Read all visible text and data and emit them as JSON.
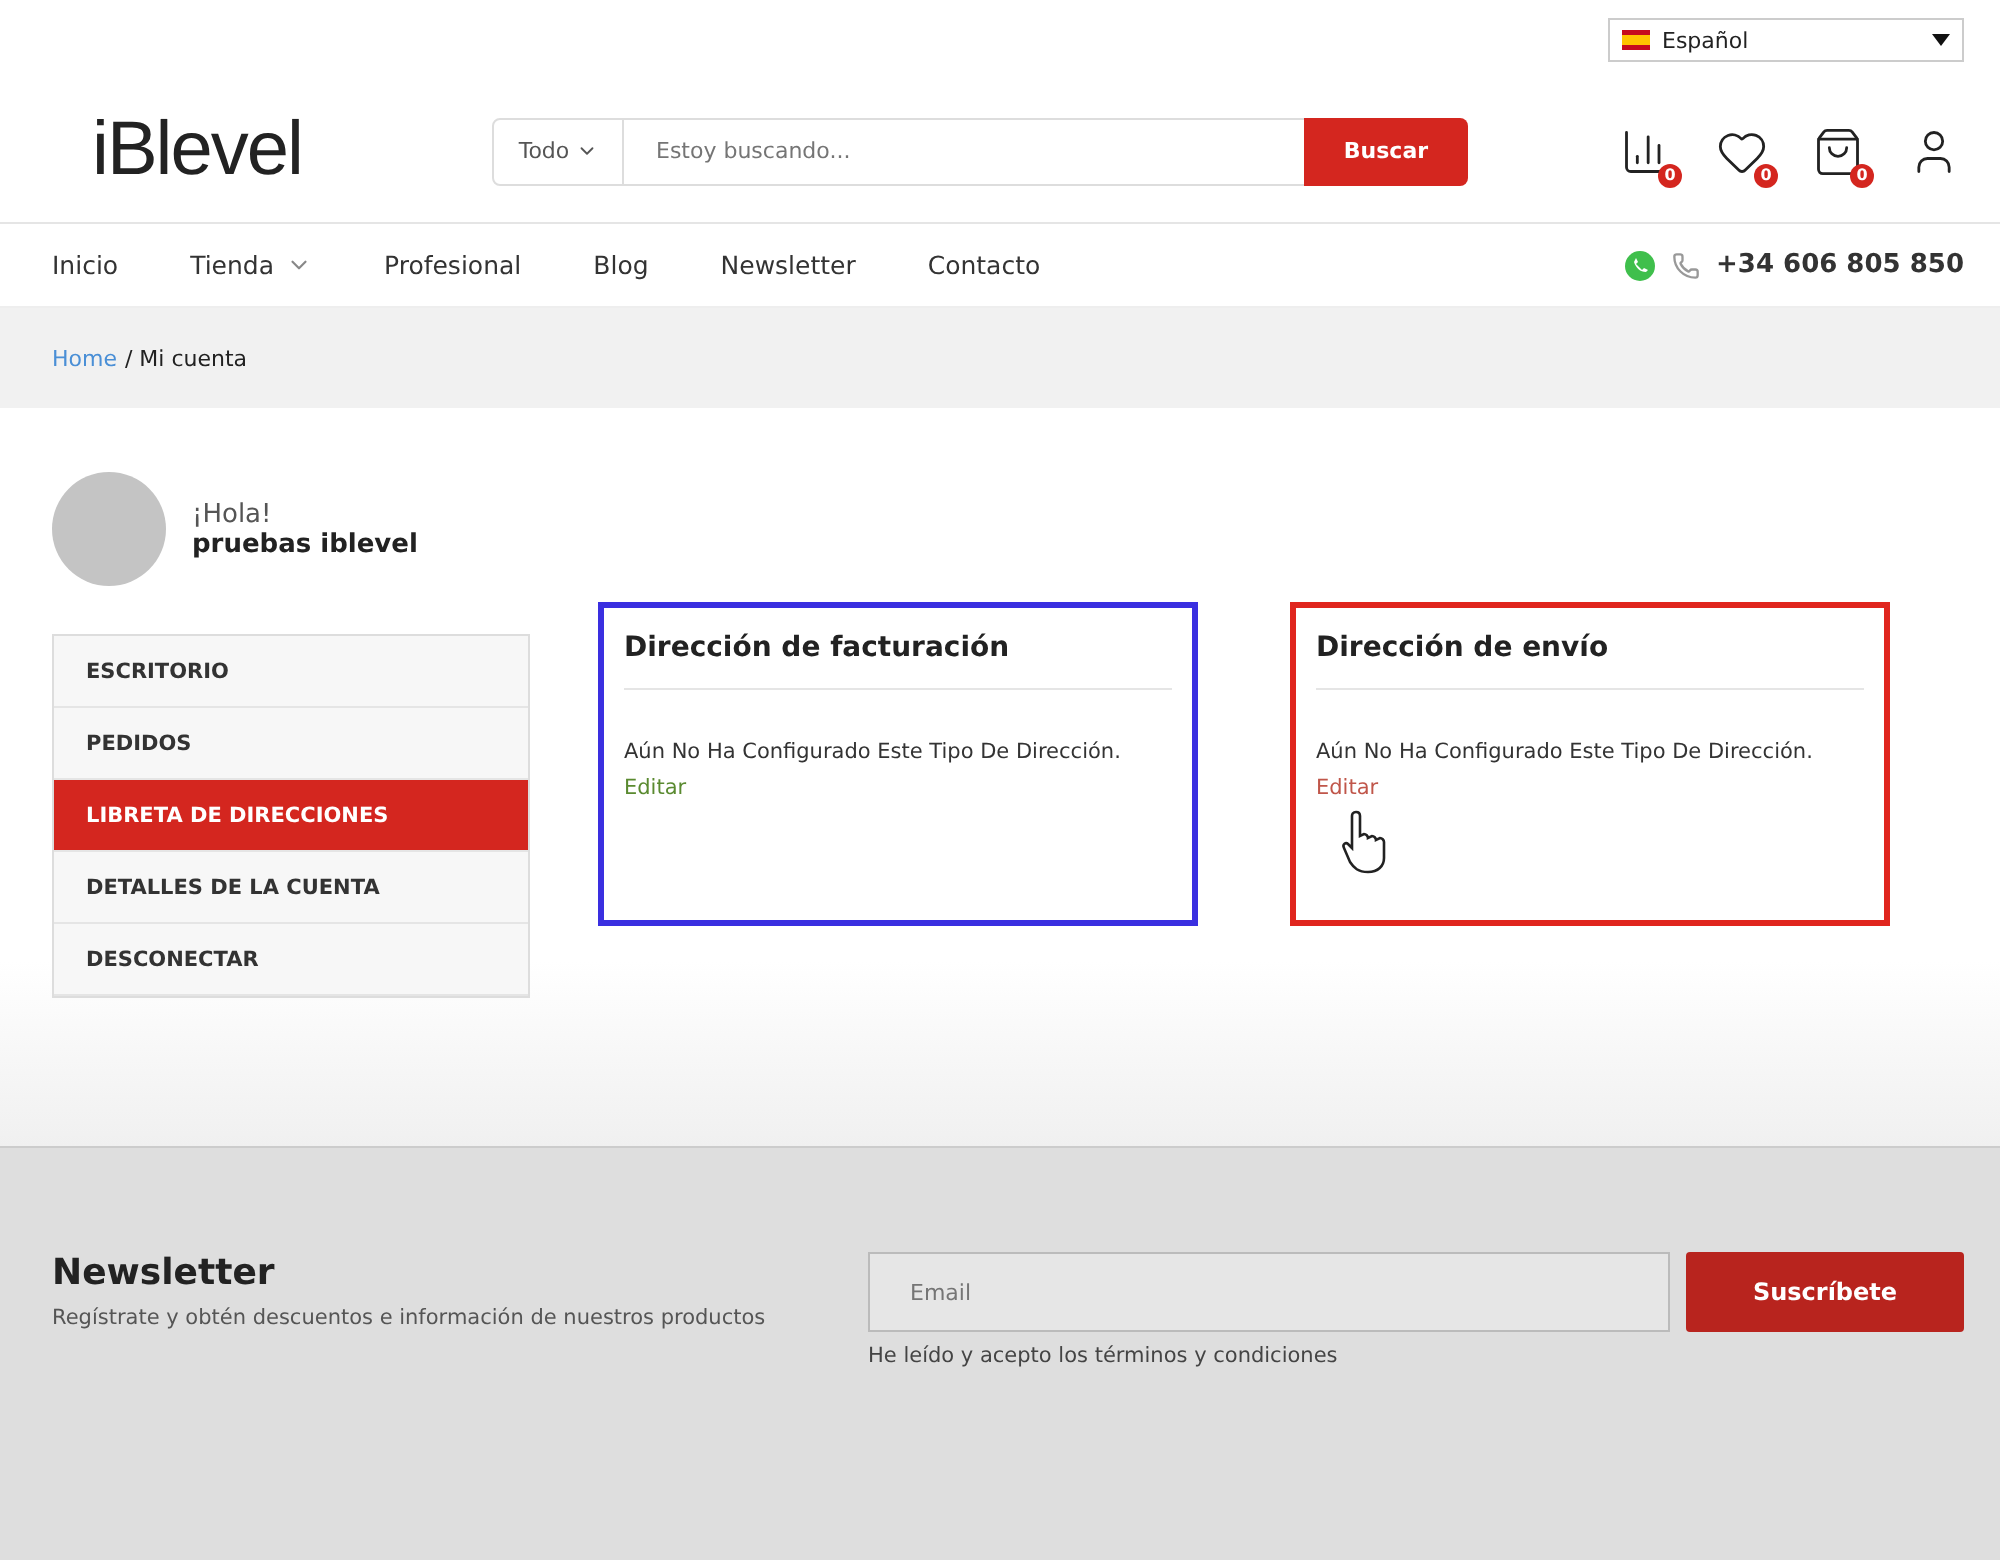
{
  "language": {
    "label": "Español"
  },
  "logo": {
    "text": "iBlevel"
  },
  "search": {
    "category": "Todo",
    "placeholder": "Estoy buscando...",
    "button": "Buscar"
  },
  "header_icons": [
    {
      "kind": "compare",
      "count": "0"
    },
    {
      "kind": "wishlist",
      "count": "0"
    },
    {
      "kind": "cart",
      "count": "0"
    },
    {
      "kind": "account"
    }
  ],
  "nav": [
    {
      "label": "Inicio",
      "has_submenu": false
    },
    {
      "label": "Tienda",
      "has_submenu": true
    },
    {
      "label": "Profesional",
      "has_submenu": false
    },
    {
      "label": "Blog",
      "has_submenu": false
    },
    {
      "label": "Newsletter",
      "has_submenu": false
    },
    {
      "label": "Contacto",
      "has_submenu": false
    }
  ],
  "phone": "+34 606 805 850",
  "breadcrumb": {
    "link": "Home",
    "current": "/ Mi cuenta"
  },
  "user": {
    "greeting": "¡Hola!",
    "name": "pruebas iblevel"
  },
  "account_menu": [
    {
      "label": "ESCRITORIO",
      "selected": false
    },
    {
      "label": "PEDIDOS",
      "selected": false
    },
    {
      "label": "LIBRETA DE DIRECCIONES",
      "selected": true
    },
    {
      "label": "DETALLES DE LA CUENTA",
      "selected": false
    },
    {
      "label": "DESCONECTAR",
      "selected": false
    }
  ],
  "addresses": [
    {
      "title": "Dirección de facturación",
      "text": "Aún No Ha Configurado Este Tipo De Dirección.",
      "link": "Editar",
      "color": "#3a2fe0",
      "hovered": false
    },
    {
      "title": "Dirección de envío",
      "text": "Aún No Ha Configurado Este Tipo De Dirección.",
      "link": "Editar",
      "color": "#e0261e",
      "hovered": true
    }
  ],
  "newsletter": {
    "title": "Newsletter",
    "subtitle": "Regístrate y obtén descuentos e información de nuestros productos",
    "placeholder": "Email",
    "button": "Suscríbete",
    "terms": "He leído y acepto los términos y condiciones"
  }
}
